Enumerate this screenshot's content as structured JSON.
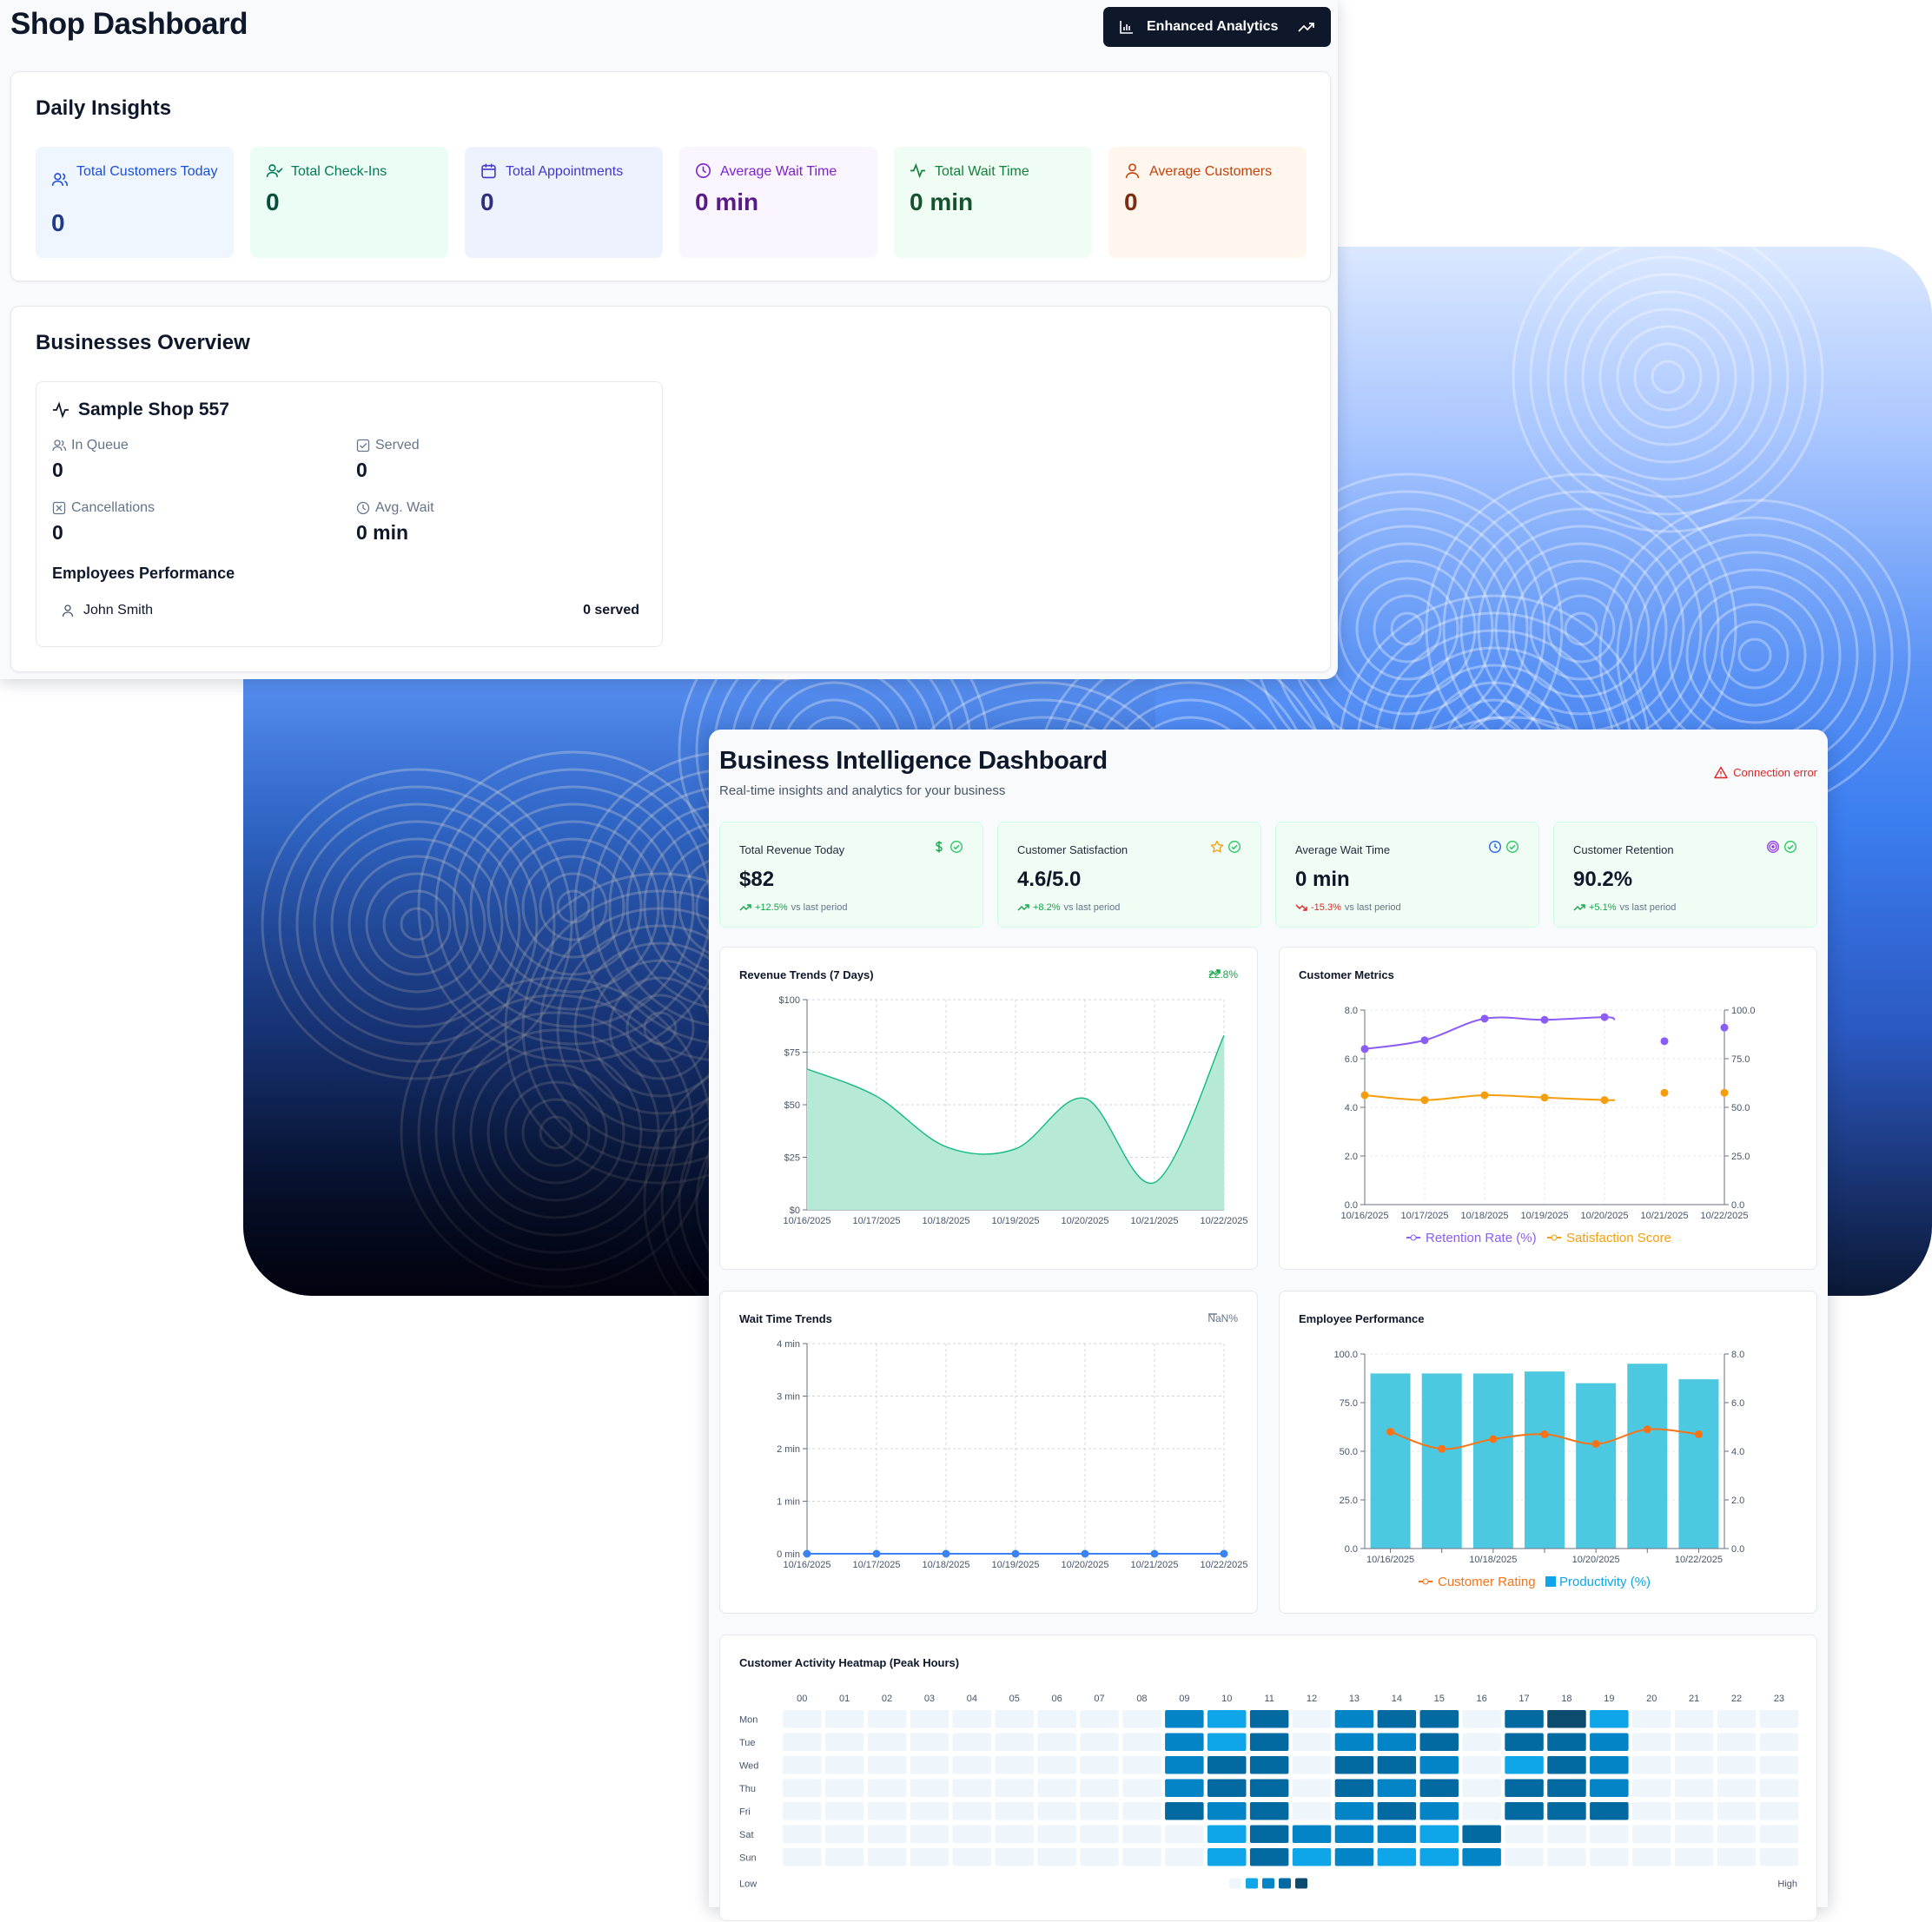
{
  "shop": {
    "title": "Shop Dashboard",
    "enhanced_button": "Enhanced Analytics",
    "daily_title": "Daily Insights",
    "stats": [
      {
        "label": "Total Customers Today",
        "value": "0",
        "icon": "users-icon",
        "bg": "#eff6ff",
        "fg": "#1d4ed8",
        "vc": "#1e3a8a"
      },
      {
        "label": "Total Check-Ins",
        "value": "0",
        "icon": "user-check-icon",
        "bg": "#ecfdf5",
        "fg": "#047857",
        "vc": "#064e3b"
      },
      {
        "label": "Total Appointments",
        "value": "0",
        "icon": "calendar-icon",
        "bg": "#eef2ff",
        "fg": "#4338ca",
        "vc": "#312e81"
      },
      {
        "label": "Average Wait Time",
        "value": "0 min",
        "icon": "clock-icon",
        "bg": "#faf5ff",
        "fg": "#7e22ce",
        "vc": "#581c87"
      },
      {
        "label": "Total Wait Time",
        "value": "0 min",
        "icon": "activity-icon",
        "bg": "#f0fdf4",
        "fg": "#15803d",
        "vc": "#14532d"
      },
      {
        "label": "Average Customers",
        "value": "0",
        "icon": "user-icon",
        "bg": "#fff7ed",
        "fg": "#c2410c",
        "vc": "#7c2d12"
      }
    ],
    "business_title": "Businesses Overview",
    "business": {
      "name": "Sample Shop 557",
      "in_queue_label": "In Queue",
      "in_queue": "0",
      "served_label": "Served",
      "served": "0",
      "cancel_label": "Cancellations",
      "cancel": "0",
      "avg_wait_label": "Avg. Wait",
      "avg_wait": "0 min",
      "emp_title": "Employees Performance",
      "employee": "John Smith",
      "employee_served": "0 served"
    }
  },
  "bi": {
    "title": "Business Intelligence Dashboard",
    "subtitle": "Real-time insights and analytics for your business",
    "connection": "Connection error",
    "kpis": [
      {
        "title": "Total Revenue Today",
        "value": "$82",
        "change": "+12.5%",
        "suffix": "vs last period",
        "dir": "up",
        "icon": "dollar-icon",
        "icolor": "#16a34a"
      },
      {
        "title": "Customer Satisfaction",
        "value": "4.6/5.0",
        "change": "+8.2%",
        "suffix": "vs last period",
        "dir": "up",
        "icon": "star-icon",
        "icolor": "#f59e0b"
      },
      {
        "title": "Average Wait Time",
        "value": "0 min",
        "change": "-15.3%",
        "suffix": "vs last period",
        "dir": "down",
        "icon": "clock-icon",
        "icolor": "#2563eb"
      },
      {
        "title": "Customer Retention",
        "value": "90.2%",
        "change": "+5.1%",
        "suffix": "vs last period",
        "dir": "up",
        "icon": "target-icon",
        "icolor": "#9333ea"
      }
    ],
    "revenue_title": "Revenue Trends (7 Days)",
    "revenue_change": "22.8%",
    "customer_title": "Customer Metrics",
    "wait_title": "Wait Time Trends",
    "wait_change": "NaN%",
    "employee_title": "Employee Performance",
    "heatmap_title": "Customer Activity Heatmap (Peak Hours)",
    "heatmap_low": "Low",
    "heatmap_high": "High"
  },
  "chart_data": [
    {
      "type": "area",
      "title": "Revenue Trends (7 Days)",
      "x": [
        "10/16/2025",
        "10/17/2025",
        "10/18/2025",
        "10/19/2025",
        "10/20/2025",
        "10/21/2025",
        "10/22/2025"
      ],
      "values": [
        67,
        54,
        30,
        29,
        53,
        13,
        83
      ],
      "ylim": [
        0,
        100
      ],
      "yticks": [
        "$0",
        "$25",
        "$50",
        "$75",
        "$100"
      ],
      "color": "#10b981"
    },
    {
      "type": "line",
      "title": "Customer Metrics",
      "x": [
        "10/16/2025",
        "10/17/2025",
        "10/18/2025",
        "10/19/2025",
        "10/20/2025",
        "10/21/2025",
        "10/22/2025"
      ],
      "series": [
        {
          "name": "Retention Rate (%)",
          "axis": "right",
          "values": [
            80.0,
            84.5,
            95.6,
            95.0,
            96.4,
            84.0,
            91.0
          ],
          "color": "#8b5cf6"
        },
        {
          "name": "Satisfaction Score",
          "axis": "left",
          "values": [
            4.5,
            4.3,
            4.5,
            4.4,
            4.3,
            4.6,
            4.6
          ],
          "color": "#f59e0b"
        }
      ],
      "ylim_left": [
        0,
        8
      ],
      "yticks_left": [
        "0.0",
        "2.0",
        "4.0",
        "6.0",
        "8.0"
      ],
      "ylim_right": [
        0,
        100
      ],
      "yticks_right": [
        "0.0",
        "25.0",
        "50.0",
        "75.0",
        "100.0"
      ]
    },
    {
      "type": "line",
      "title": "Wait Time Trends",
      "x": [
        "10/16/2025",
        "10/17/2025",
        "10/18/2025",
        "10/19/2025",
        "10/20/2025",
        "10/21/2025",
        "10/22/2025"
      ],
      "values": [
        0,
        0,
        0,
        0,
        0,
        0,
        0
      ],
      "ylim": [
        0,
        4
      ],
      "yticks": [
        "0 min",
        "1 min",
        "2 min",
        "3 min",
        "4 min"
      ],
      "color": "#3b82f6"
    },
    {
      "type": "bar",
      "title": "Employee Performance",
      "x": [
        "10/16/2025",
        "",
        "10/18/2025",
        "",
        "10/20/2025",
        "",
        "10/22/2025"
      ],
      "series": [
        {
          "name": "Productivity (%)",
          "axis": "left",
          "values": [
            90,
            90,
            90,
            91,
            85,
            95,
            87
          ],
          "color": "#4cc9e0"
        },
        {
          "name": "Customer Rating",
          "axis": "right",
          "values": [
            4.8,
            4.1,
            4.5,
            4.7,
            4.3,
            4.9,
            4.7
          ],
          "color": "#f97316"
        }
      ],
      "ylim_left": [
        0,
        100
      ],
      "yticks_left": [
        "0.0",
        "25.0",
        "50.0",
        "75.0",
        "100.0"
      ],
      "ylim_right": [
        0,
        8
      ],
      "yticks_right": [
        "0.0",
        "2.0",
        "4.0",
        "6.0",
        "8.0"
      ]
    },
    {
      "type": "heatmap",
      "title": "Customer Activity Heatmap (Peak Hours)",
      "rows": [
        "Mon",
        "Tue",
        "Wed",
        "Thu",
        "Fri",
        "Sat",
        "Sun"
      ],
      "columns": [
        "00",
        "01",
        "02",
        "03",
        "04",
        "05",
        "06",
        "07",
        "08",
        "09",
        "10",
        "11",
        "12",
        "13",
        "14",
        "15",
        "16",
        "17",
        "18",
        "19",
        "20",
        "21",
        "22",
        "23"
      ],
      "values": [
        [
          0,
          0,
          0,
          0,
          0,
          0,
          0,
          0,
          0,
          2,
          1,
          3,
          0,
          2,
          3,
          3,
          0,
          3,
          4,
          1,
          0,
          0,
          0,
          0
        ],
        [
          0,
          0,
          0,
          0,
          0,
          0,
          0,
          0,
          0,
          2,
          1,
          3,
          0,
          2,
          2,
          3,
          0,
          3,
          3,
          2,
          0,
          0,
          0,
          0
        ],
        [
          0,
          0,
          0,
          0,
          0,
          0,
          0,
          0,
          0,
          2,
          3,
          3,
          0,
          3,
          3,
          2,
          0,
          1,
          3,
          2,
          0,
          0,
          0,
          0
        ],
        [
          0,
          0,
          0,
          0,
          0,
          0,
          0,
          0,
          0,
          2,
          3,
          3,
          0,
          3,
          2,
          3,
          0,
          3,
          3,
          2,
          0,
          0,
          0,
          0
        ],
        [
          0,
          0,
          0,
          0,
          0,
          0,
          0,
          0,
          0,
          3,
          2,
          3,
          0,
          2,
          3,
          2,
          0,
          3,
          3,
          3,
          0,
          0,
          0,
          0
        ],
        [
          0,
          0,
          0,
          0,
          0,
          0,
          0,
          0,
          0,
          0,
          1,
          3,
          2,
          2,
          2,
          1,
          3,
          0,
          0,
          0,
          0,
          0,
          0,
          0
        ],
        [
          0,
          0,
          0,
          0,
          0,
          0,
          0,
          0,
          0,
          0,
          1,
          3,
          1,
          2,
          1,
          1,
          2,
          0,
          0,
          0,
          0,
          0,
          0,
          0
        ]
      ],
      "scale_colors": [
        "#eef6fc",
        "#0ea5e9",
        "#0284c7",
        "#0369a1",
        "#0c4a6e"
      ]
    }
  ]
}
